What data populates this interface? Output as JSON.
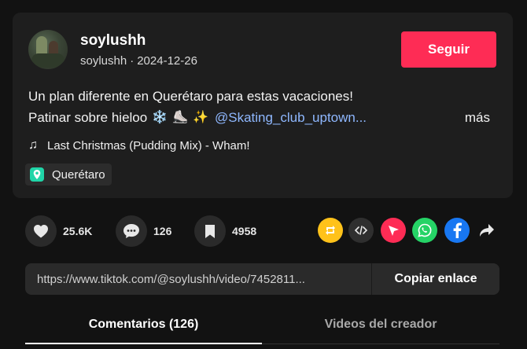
{
  "author": {
    "username": "soylushh",
    "handle": "soylushh",
    "separator": "·",
    "date": "2024-12-26"
  },
  "follow_label": "Seguir",
  "description": {
    "line1": "Un plan diferente en Querétaro para estas vacaciones!",
    "line2_text": "Patinar sobre hieloo",
    "emoji_snow": "❄️",
    "emoji_skate": "⛸️",
    "emoji_sparkles": "✨",
    "mention": "@Skating_club_uptown...",
    "more_label": "más"
  },
  "music": {
    "note_icon": "♫",
    "title": "Last Christmas (Pudding Mix) - Wham!"
  },
  "location": "Querétaro",
  "stats": {
    "likes": "25.6K",
    "comments": "126",
    "saves": "4958"
  },
  "share_icons": [
    "repost-icon",
    "embed-icon",
    "send-icon",
    "whatsapp-icon",
    "facebook-icon",
    "share-arrow-icon"
  ],
  "share_colors": {
    "repost": "#ffc21a",
    "embed": "#2f2f2f",
    "send": "#fe2c55",
    "whatsapp": "#25d366",
    "facebook": "#1877f2"
  },
  "link": {
    "url": "https://www.tiktok.com/@soylushh/video/7452811...",
    "copy_label": "Copiar enlace"
  },
  "tabs": {
    "comments": "Comentarios (126)",
    "creator_videos": "Videos del creador"
  },
  "colors": {
    "accent": "#fe2c55",
    "mention": "#8fb8ff",
    "background": "#121212",
    "card": "#1e1e1e"
  }
}
